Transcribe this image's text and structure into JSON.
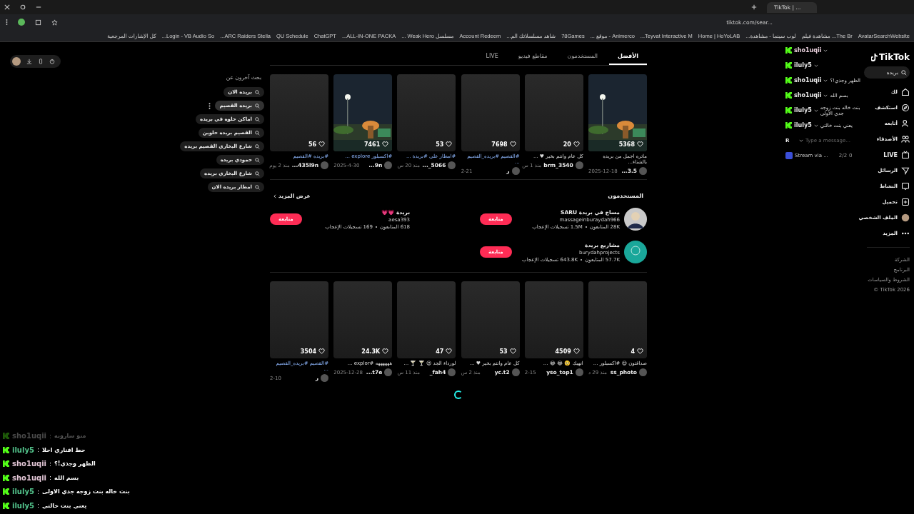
{
  "browser": {
    "tab_title": "TikTok | ...",
    "address": "tiktok.com/sear...",
    "bookmarks": [
      "AvatarSearchWebsite",
      "The Br... مشاهدة فيلم",
      "لوب سينما - مشاهدة...",
      "Home | HoYoLAB",
      "Teyvat Interactive M...",
      "Animerco - موقع ...",
      "78Games",
      "شاهد مسلسلاتك الم...",
      "Account Redeem",
      "مسلسل Weak Hero ...",
      "ALL-IN-ONE PACKA...",
      "ChatGPT",
      "QU Schedule",
      "ARC Raiders Stella...",
      "Login - VB Audio So...",
      "كل الإشارات المرجعية"
    ]
  },
  "tabs": [
    {
      "label": "الأفضل",
      "selected": true
    },
    {
      "label": "المستخدمون",
      "selected": false
    },
    {
      "label": "مقاطع فيديو",
      "selected": false
    },
    {
      "label": "LIVE",
      "selected": false
    }
  ],
  "related_searches": {
    "title": "بحث آخرون عن",
    "items": [
      {
        "label": "بريده الان",
        "hovered": false
      },
      {
        "label": "بريده القصيم",
        "hovered": true
      },
      {
        "label": "اماكن حلوه في بريده",
        "hovered": false
      },
      {
        "label": "القصيم بريده حلوين",
        "hovered": false
      },
      {
        "label": "شارع البخاري القصيم بريده",
        "hovered": false
      },
      {
        "label": "حمودي بريده",
        "hovered": false
      },
      {
        "label": "شارع البخاري بريده",
        "hovered": false
      },
      {
        "label": "امطار بريده الان",
        "hovered": false
      }
    ]
  },
  "videos_top": [
    {
      "kind": "picture",
      "likes": "5368",
      "caption": "ماتره اجمل من بريده بالشتاء...",
      "hashtags": false,
      "author": "3.5...",
      "date": "2025-12-18"
    },
    {
      "kind": "blank",
      "likes": "20",
      "caption": "كل عام وانتم بخير ♥ ...",
      "hashtags": false,
      "author": "brm_3540",
      "date": "منذ 1 س"
    },
    {
      "kind": "blank",
      "likes": "7698",
      "caption": "#القصيم #بريده_القصيم ...",
      "hashtags": true,
      "author": "ر",
      "date": "2-21"
    },
    {
      "kind": "blank",
      "likes": "53",
      "caption": "#امطار على #بريدة ...",
      "hashtags": true,
      "author": "5066_...",
      "date": "منذ 20 س"
    },
    {
      "kind": "picture",
      "likes": "7461",
      "caption": "#اكسبلور explore ...",
      "hashtags": true,
      "author": "9n...",
      "date": "2025-4-30"
    },
    {
      "kind": "blank",
      "likes": "56",
      "caption": "#بريده #القصيم",
      "hashtags": true,
      "author": "435l9n...",
      "date": "منذ 2 يوم"
    }
  ],
  "users": {
    "title": "المستخدمون",
    "see_more": "عرض المزيد",
    "items": [
      {
        "name": "مساج في بريدة SARU",
        "handle": "massageinburaydah966",
        "followers": "28K المتابعون",
        "likes": "1.5M تسجيلات الإعجاب",
        "follow": "متابعة"
      },
      {
        "name": "بريدة 💗💗",
        "handle": "aesa393",
        "followers": "618 المتابعون",
        "likes": "169 تسجيلات الإعجاب",
        "follow": "متابعة"
      },
      {
        "avatar": {
          "kind": "logo"
        },
        "name": "مشاريع بريدة",
        "handle": "burydahprojects",
        "followers": "57.7K المتابعون",
        "likes": "643.8K تسجيلات الإعجاب",
        "follow": "متابعة"
      }
    ]
  },
  "videos_bottom": [
    {
      "kind": "blank",
      "likes": "4",
      "caption": "صداقتون 😍 #اكسبلور ...",
      "hashtags": false,
      "author": "ss_photo",
      "date": "منذ 29 د"
    },
    {
      "kind": "blank",
      "likes": "4509",
      "caption": "انهيك 🥺 😂 😂 ...",
      "hashtags": false,
      "author": "yso_top1",
      "date": "2-15"
    },
    {
      "kind": "blank",
      "likes": "53",
      "caption": "كل عام وانتم بخير ♥ ...",
      "hashtags": false,
      "author": "yc.t2",
      "date": "منذ 2 س"
    },
    {
      "kind": "blank",
      "likes": "47",
      "caption": "لورداء الجد 😍 🍸 🍸 ...",
      "hashtags": false,
      "author": "fah4_",
      "date": "منذ 11 س"
    },
    {
      "kind": "blank",
      "likes": "24.3K",
      "caption": "ههههههه #explor ...",
      "hashtags": false,
      "author": "t7e...",
      "date": "2025-12-28"
    },
    {
      "kind": "blank",
      "likes": "3504",
      "caption": "#القصيم #بريده_القصيم ...",
      "hashtags": true,
      "author": "ر",
      "date": "2-10"
    }
  ],
  "sidebar": {
    "logo": "TikTok",
    "search": "بريده",
    "items": [
      {
        "kind": "home",
        "label": "لك"
      },
      {
        "kind": "compass",
        "label": "استكشف"
      },
      {
        "kind": "following",
        "label": "أتابعه"
      },
      {
        "kind": "friends",
        "label": "الأصدقاء"
      },
      {
        "kind": "live",
        "label": "LIVE"
      },
      {
        "kind": "send",
        "label": "الرسائل"
      },
      {
        "kind": "activity",
        "label": "النشاط"
      },
      {
        "kind": "upload",
        "label": "تحميل"
      },
      {
        "kind": "profile",
        "label": "الملف الشخصي"
      },
      {
        "kind": "more",
        "label": "المزيد"
      }
    ],
    "footer": [
      "الشركة",
      "البرنامج",
      "الشروط والسياسات",
      "© TikTok 2026"
    ]
  },
  "stream_chat_overlay": {
    "messages": [
      {
        "user": "sho1uqii",
        "color": "#e8d0dc"
      },
      {
        "user": "iluly5",
        "color": "#e8e8e8"
      },
      {
        "user": "sho1uqii",
        "color": "#e8e8e8",
        "message": "الظهر وجذي!؟"
      },
      {
        "user": "sho1uqii",
        "color": "#e8e8e8",
        "message": "بسم الله"
      },
      {
        "user": "iluly5",
        "color": "#e8e8e8",
        "message": "بنت خاله بنت زوجه جدي الاولى"
      },
      {
        "user": "iluly5",
        "color": "#e8e8e8",
        "message": "يعني بنت خالتي"
      }
    ],
    "account": "R",
    "placeholder": "Type a message...",
    "stream_label": "Stream via ...",
    "viewers": "2/2",
    "count": "0"
  },
  "chat_log": [
    {
      "user": "sho1uqii",
      "color": "#4a4a4a",
      "separator": ":",
      "message": "متو سارونه",
      "faded": true
    },
    {
      "user": "iluly5",
      "color": "#53c48c",
      "separator": ":",
      "message": "حط افتاري احلا",
      "faded": false
    },
    {
      "user": "sho1uqii",
      "color": "#e3c6d6",
      "separator": ":",
      "message": "الظهر وجذي!؟",
      "faded": false
    },
    {
      "user": "sho1uqii",
      "color": "#e3c6d6",
      "separator": ":",
      "message": "بسم الله",
      "faded": false
    },
    {
      "user": "iluly5",
      "color": "#53c48c",
      "separator": ":",
      "message": "بنت خاله بنت زوجه جدي الاولى",
      "faded": false
    },
    {
      "user": "iluly5",
      "color": "#53c48c",
      "separator": ":",
      "message": "يعني بنت خالتي",
      "faded": false
    }
  ]
}
